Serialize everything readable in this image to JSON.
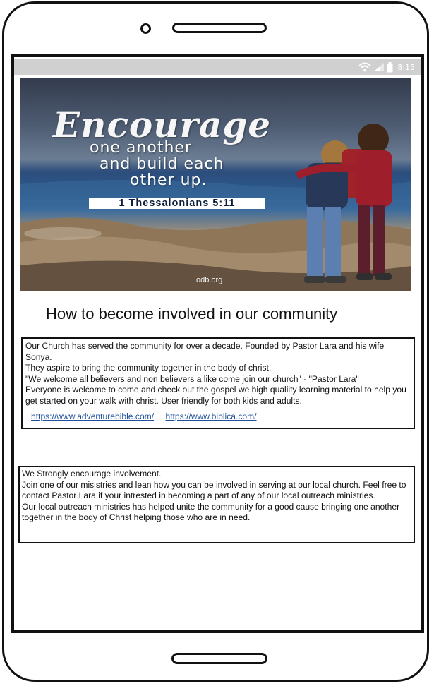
{
  "status_bar": {
    "time": "8:15",
    "icons": [
      "wifi-icon",
      "signal-icon",
      "battery-icon"
    ]
  },
  "banner": {
    "script_word": "Encourage",
    "lines": [
      "one another",
      "and build each",
      "other up."
    ],
    "verse": "1 Thessalonians 5:11",
    "watermark": "odb.org"
  },
  "section": {
    "title": "How to become involved in our community"
  },
  "about_box": {
    "paragraphs": [
      "Our Church has served the community for over a decade. Founded by Pastor Lara and his wife Sonya.",
      "They aspire to bring the community together in the body of christ.",
      "\"We welcome all believers and non believers a like come join our church\" - \"Pastor Lara\"",
      "Everyone is welcome to come and check out the gospel we high qualiity learning material to help you get started on your walk with christ. User friendly for both kids and adults."
    ],
    "links": [
      "https://www.adventurebible.com/",
      "https://www.biblica.com/"
    ]
  },
  "involvement_box": {
    "paragraphs": [
      "We Strongly encourage involvement.",
      "Join one of our misistries and lean how you can be involved in serving at our local church. Feel free to contact Pastor Lara if your intrested in becoming a part of any of our local outreach ministries.",
      "Our local outreach ministries has helped unite the community for a good cause bringing one another together in the body of Christ helping those who are in need."
    ]
  },
  "colors": {
    "link": "#1f4f9a",
    "status_bar": "#d0d0d0",
    "border": "#111111"
  }
}
